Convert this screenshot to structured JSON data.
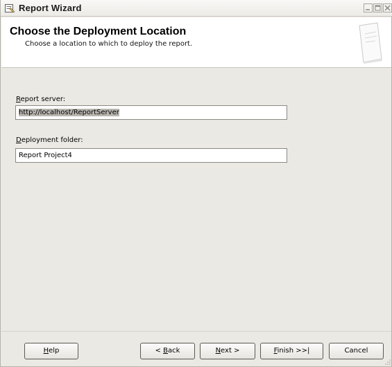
{
  "window": {
    "title": "Report Wizard"
  },
  "header": {
    "title": "Choose the Deployment Location",
    "subtitle": "Choose a location to which to deploy the report."
  },
  "form": {
    "report_server": {
      "label_mnemonic": "R",
      "label_rest": "eport server:",
      "value": "http://localhost/ReportServer"
    },
    "deployment_folder": {
      "label_mnemonic": "D",
      "label_rest": "eployment folder:",
      "value": "Report Project4"
    }
  },
  "buttons": {
    "help": {
      "mnemonic": "H",
      "rest": "elp"
    },
    "back": {
      "prefix": "< ",
      "mnemonic": "B",
      "rest": "ack"
    },
    "next": {
      "mnemonic": "N",
      "rest": "ext >"
    },
    "finish": {
      "mnemonic": "F",
      "rest": "inish >>|"
    },
    "cancel": {
      "label": "Cancel"
    }
  },
  "icons": {
    "app": "report-wizard-icon",
    "minimize": "minimize-icon",
    "maximize": "maximize-icon",
    "close": "close-icon",
    "header": "document-page-icon",
    "grip": "resize-grip-icon"
  },
  "colors": {
    "dialog_background": "#ebe9e3",
    "header_background": "#ffffff",
    "selection": "#b9b6b0"
  }
}
